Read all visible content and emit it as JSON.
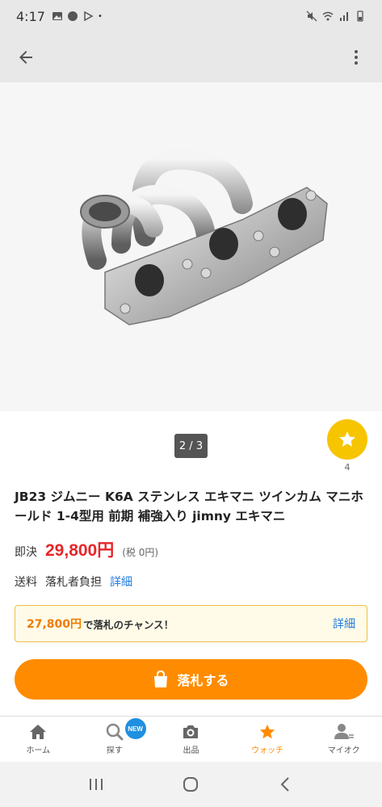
{
  "status_bar": {
    "time": "4:17"
  },
  "app_bar": {
    "back_icon": "arrow-left-icon",
    "menu_icon": "more-vert-icon"
  },
  "gallery": {
    "pager": "2 / 3",
    "watch_count": "4"
  },
  "item": {
    "title": "JB23 ジムニー K6A ステンレス エキマニ ツインカム マニホールド 1-4型用 前期 補強入り jimny エキマニ",
    "price_label": "即決",
    "price": "29,800円",
    "tax": "(税 0円)",
    "shipping_label": "送料",
    "shipping_value": "落札者負担",
    "shipping_detail": "詳細"
  },
  "chance": {
    "amount": "27,800円",
    "text": "で落札のチャンス！",
    "detail": "詳細"
  },
  "bid_button": {
    "label": "落札する"
  },
  "tabs": [
    {
      "label": "ホーム",
      "icon": "home-icon"
    },
    {
      "label": "探す",
      "icon": "search-icon",
      "badge": "NEW"
    },
    {
      "label": "出品",
      "icon": "camera-icon"
    },
    {
      "label": "ウォッチ",
      "icon": "star-icon"
    },
    {
      "label": "マイオク",
      "icon": "person-icon"
    }
  ],
  "colors": {
    "accent": "#ff8c00",
    "price": "#e5262a",
    "link": "#1f7ce0",
    "watch": "#f7c400"
  }
}
